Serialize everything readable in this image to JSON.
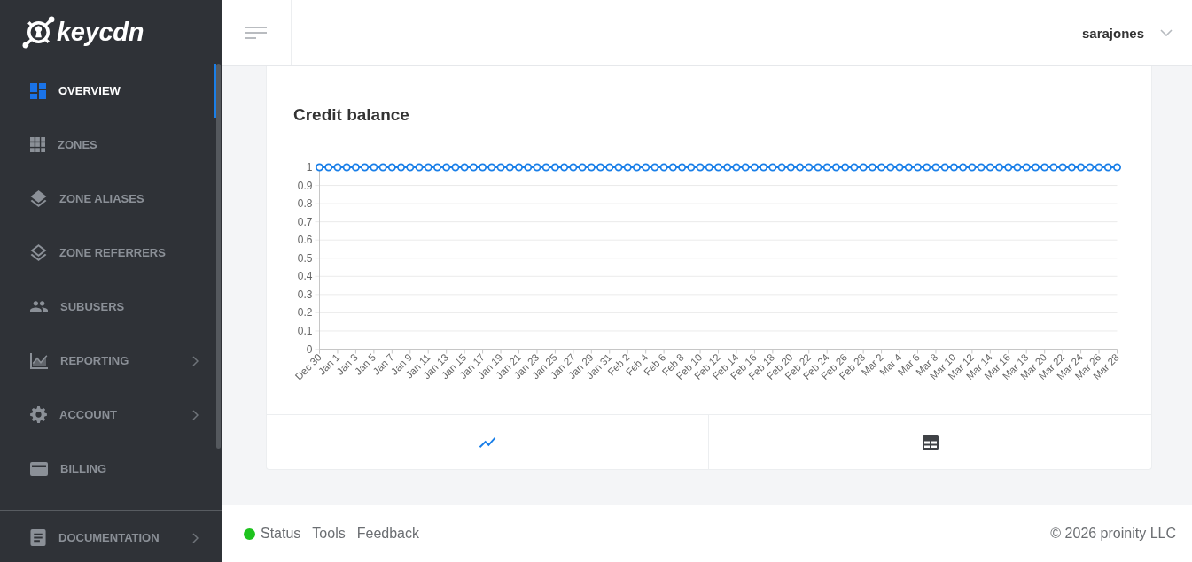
{
  "sidebar": {
    "logo": "keycdn",
    "nav": [
      {
        "label": "OVERVIEW",
        "selected": true,
        "expandable": false
      },
      {
        "label": "ZONES",
        "selected": false,
        "expandable": false
      },
      {
        "label": "ZONE ALIASES",
        "selected": false,
        "expandable": false
      },
      {
        "label": "ZONE REFERRERS",
        "selected": false,
        "expandable": false
      },
      {
        "label": "SUBUSERS",
        "selected": false,
        "expandable": false
      },
      {
        "label": "REPORTING",
        "selected": false,
        "expandable": true
      },
      {
        "label": "ACCOUNT",
        "selected": false,
        "expandable": true
      },
      {
        "label": "BILLING",
        "selected": false,
        "expandable": false
      }
    ],
    "nav_bottom": [
      {
        "label": "DOCUMENTATION",
        "selected": false,
        "expandable": true
      }
    ]
  },
  "header": {
    "user": "sarajones"
  },
  "card": {
    "chart_data": {
      "type": "line",
      "title": "Credit balance",
      "grid": true,
      "ylim": [
        0,
        1
      ],
      "yticks": [
        0,
        0.1,
        0.2,
        0.3,
        0.4,
        0.5,
        0.6,
        0.7,
        0.8,
        0.9,
        1
      ],
      "categories": [
        "Dec 30",
        null,
        "Jan 1",
        null,
        "Jan 3",
        null,
        "Jan 5",
        null,
        "Jan 7",
        null,
        "Jan 9",
        null,
        "Jan 11",
        null,
        "Jan 13",
        null,
        "Jan 15",
        null,
        "Jan 17",
        null,
        "Jan 19",
        null,
        "Jan 21",
        null,
        "Jan 23",
        null,
        "Jan 25",
        null,
        "Jan 27",
        null,
        "Jan 29",
        null,
        "Jan 31",
        null,
        "Feb 2",
        null,
        "Feb 4",
        null,
        "Feb 6",
        null,
        "Feb 8",
        null,
        "Feb 10",
        null,
        "Feb 12",
        null,
        "Feb 14",
        null,
        "Feb 16",
        null,
        "Feb 18",
        null,
        "Feb 20",
        null,
        "Feb 22",
        null,
        "Feb 24",
        null,
        "Feb 26",
        null,
        "Feb 28",
        null,
        "Mar 2",
        null,
        "Mar 4",
        null,
        "Mar 6",
        null,
        "Mar 8",
        null,
        "Mar 10",
        null,
        "Mar 12",
        null,
        "Mar 14",
        null,
        "Mar 16",
        null,
        "Mar 18",
        null,
        "Mar 20",
        null,
        "Mar 22",
        null,
        "Mar 24",
        null,
        "Mar 26",
        null,
        "Mar 28"
      ],
      "series": [
        {
          "color": "#1a7fe8",
          "marker": true,
          "values": [
            1,
            1,
            1,
            1,
            1,
            1,
            1,
            1,
            1,
            1,
            1,
            1,
            1,
            1,
            1,
            1,
            1,
            1,
            1,
            1,
            1,
            1,
            1,
            1,
            1,
            1,
            1,
            1,
            1,
            1,
            1,
            1,
            1,
            1,
            1,
            1,
            1,
            1,
            1,
            1,
            1,
            1,
            1,
            1,
            1,
            1,
            1,
            1,
            1,
            1,
            1,
            1,
            1,
            1,
            1,
            1,
            1,
            1,
            1,
            1,
            1,
            1,
            1,
            1,
            1,
            1,
            1,
            1,
            1,
            1,
            1,
            1,
            1,
            1,
            1,
            1,
            1,
            1,
            1,
            1,
            1,
            1,
            1,
            1,
            1,
            1,
            1,
            1,
            1
          ]
        }
      ]
    },
    "views": [
      {
        "kind": "chart",
        "selected": true
      },
      {
        "kind": "table",
        "selected": false
      }
    ]
  },
  "footer": {
    "status": {
      "label": "Status",
      "color": "#1ec31e"
    },
    "links": [
      "Tools",
      "Feedback"
    ],
    "copyright": "© 2026 proinity LLC"
  }
}
